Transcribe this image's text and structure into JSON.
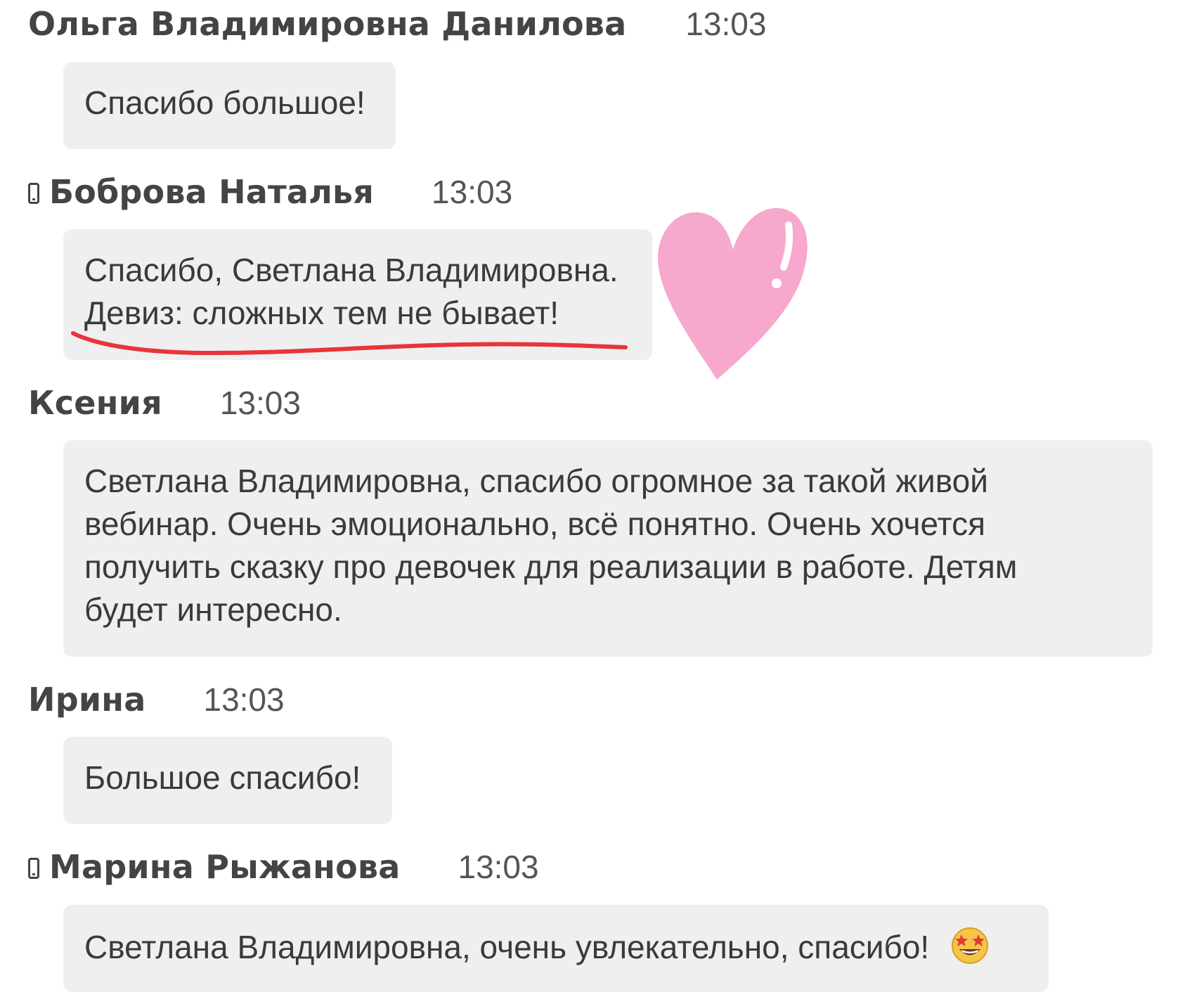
{
  "messages": [
    {
      "sender": "Ольга Владимировна Данилова",
      "time": "13:03",
      "mobile": false,
      "text": "Спасибо большое!"
    },
    {
      "sender": "Боброва Наталья",
      "time": "13:03",
      "mobile": true,
      "text": "Спасибо, Светлана Владимировна.\nДевиз: сложных тем не бывает!"
    },
    {
      "sender": "Ксения",
      "time": "13:03",
      "mobile": false,
      "text": "Светлана Владимировна, спасибо огромное за такой живой\nвебинар. Очень эмоционально, всё понятно. Очень хочется\nполучить сказку про девочек для реализации в работе. Детям\nбудет интересно."
    },
    {
      "sender": "Ирина",
      "time": "13:03",
      "mobile": false,
      "text": "Большое спасибо!"
    },
    {
      "sender": "Марина Рыжанова",
      "time": "13:03",
      "mobile": true,
      "text": "Светлана Владимировна, очень увлекательно, спасибо!",
      "emoji": "star-struck-emoji-icon"
    }
  ],
  "decorations": {
    "heart": {
      "icon": "heart-sticker-icon",
      "color": "#f7a8cd",
      "highlight": "#ffffff"
    },
    "underline": {
      "color": "#e8343a"
    }
  },
  "colors": {
    "bubble_bg": "#efefef",
    "sender_text": "#444444",
    "time_text": "#555555",
    "message_text": "#3a3a3a"
  }
}
